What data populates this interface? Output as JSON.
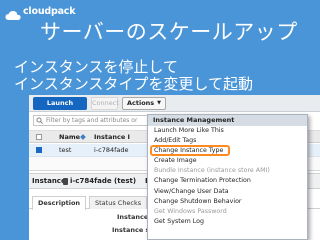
{
  "brand": {
    "name": "cloudpack"
  },
  "slide": {
    "title": "サーバーのスケールアップ",
    "subtitle_line1": "インスタンスを停止して",
    "subtitle_line2": "インスタンスタイプを変更して起動"
  },
  "toolbar": {
    "launch_label": "Launch Instance",
    "connect_label": "Connect",
    "actions_label": "Actions"
  },
  "filter": {
    "placeholder": "Filter by tags and attributes or"
  },
  "grid": {
    "headers": [
      "Name",
      "Instance I"
    ],
    "row": {
      "name": "test",
      "instance_id": "i-c784fade"
    }
  },
  "detail": {
    "label": "Instance:",
    "value": "i-c784fade (test)",
    "value_suffix": "P"
  },
  "tabs": [
    "Description",
    "Status Checks"
  ],
  "fields": [
    "Instance ID",
    "Instance state"
  ],
  "menu": {
    "header": "Instance Management",
    "items": [
      {
        "label": "Launch More Like This",
        "enabled": true
      },
      {
        "label": "Add/Edit Tags",
        "enabled": true
      },
      {
        "label": "Change Instance Type",
        "enabled": true,
        "highlighted": true
      },
      {
        "label": "Create Image",
        "enabled": true
      },
      {
        "label": "Bundle Instance (instance store AMI)",
        "enabled": false
      },
      {
        "label": "Change Termination Protection",
        "enabled": true
      },
      {
        "label": "View/Change User Data",
        "enabled": true
      },
      {
        "label": "Change Shutdown Behavior",
        "enabled": true
      },
      {
        "label": "Get Windows Password",
        "enabled": false
      },
      {
        "label": "Get System Log",
        "enabled": true
      }
    ]
  },
  "colors": {
    "background": "#4a95d8",
    "launch_button": "#1566c0",
    "highlight_ring": "#ff8a1f"
  }
}
